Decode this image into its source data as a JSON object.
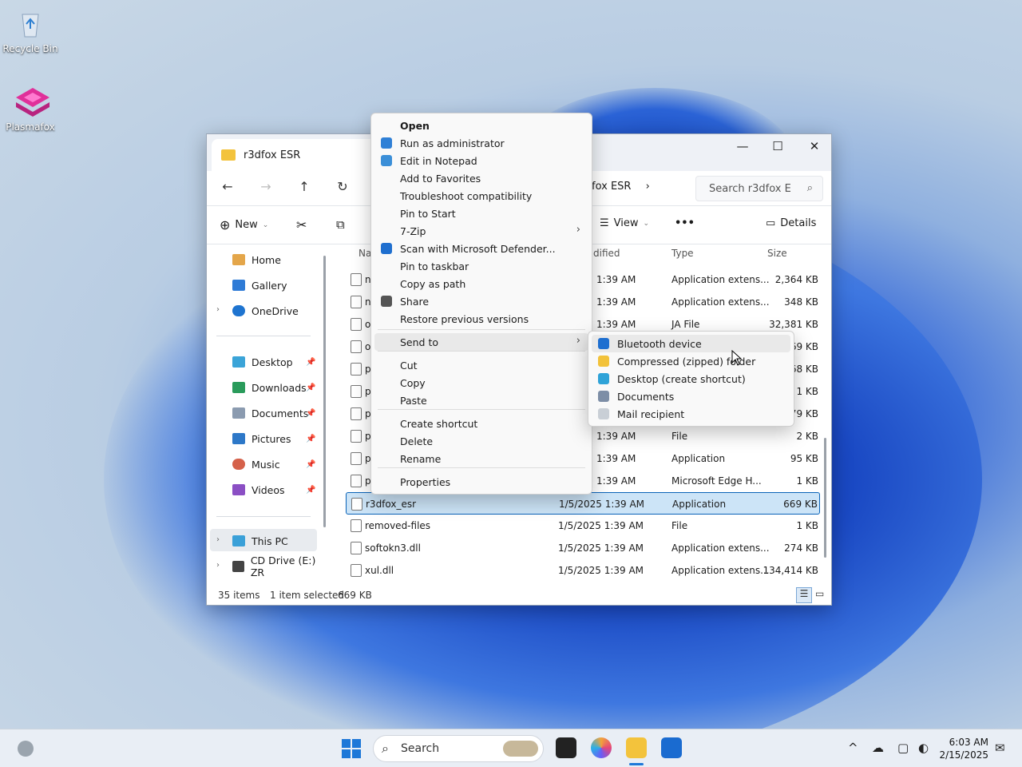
{
  "desktop": {
    "icons": [
      {
        "label": "Recycle Bin",
        "icon": "recycle-bin-icon"
      },
      {
        "label": "Plasmafox",
        "icon": "plasmafox-icon"
      }
    ]
  },
  "explorer": {
    "tab_title": "r3dfox ESR",
    "window_buttons": {
      "minimize": "—",
      "maximize": "☐",
      "close": "✕"
    },
    "nav": {
      "back": "←",
      "forward": "→",
      "up": "↑",
      "refresh": "↻"
    },
    "breadcrumb": "fox ESR",
    "breadcrumb_chevron": "›",
    "search_placeholder": "Search r3dfox E",
    "commands": {
      "new": "New",
      "view": "View",
      "more": "•••",
      "details": "Details"
    },
    "sidebar": {
      "home": "Home",
      "gallery": "Gallery",
      "onedrive": "OneDrive",
      "desktop": "Desktop",
      "downloads": "Downloads",
      "documents": "Documents",
      "pictures": "Pictures",
      "music": "Music",
      "videos": "Videos",
      "this_pc": "This PC",
      "cd_drive": "CD Drive (E:) ZR"
    },
    "columns": {
      "name": "Na",
      "modified": "dified",
      "type": "Type",
      "size": "Size"
    },
    "rows": [
      {
        "name": "n",
        "modified": "1:39 AM",
        "type": "Application extens...",
        "size": "2,364 KB"
      },
      {
        "name": "n",
        "modified": "1:39 AM",
        "type": "Application extens...",
        "size": "348 KB"
      },
      {
        "name": "o",
        "modified": "1:39 AM",
        "type": "JA File",
        "size": "32,381 KB"
      },
      {
        "name": "o",
        "modified": "",
        "type": "",
        "size": "69 KB"
      },
      {
        "name": "p",
        "modified": "",
        "type": "",
        "size": "68 KB"
      },
      {
        "name": "p",
        "modified": "",
        "type": "",
        "size": "1 KB"
      },
      {
        "name": "p",
        "modified": "",
        "type": "",
        "size": "279 KB"
      },
      {
        "name": "p",
        "modified": "1:39 AM",
        "type": "File",
        "size": "2 KB"
      },
      {
        "name": "p",
        "modified": "1:39 AM",
        "type": "Application",
        "size": "95 KB"
      },
      {
        "name": "p",
        "modified": "1:39 AM",
        "type": "Microsoft Edge H...",
        "size": "1 KB"
      },
      {
        "name": "r3dfox_esr",
        "modified": "1/5/2025 1:39 AM",
        "type": "Application",
        "size": "669 KB"
      },
      {
        "name": "removed-files",
        "modified": "1/5/2025 1:39 AM",
        "type": "File",
        "size": "1 KB"
      },
      {
        "name": "softokn3.dll",
        "modified": "1/5/2025 1:39 AM",
        "type": "Application extens...",
        "size": "274 KB"
      },
      {
        "name": "xul.dll",
        "modified": "1/5/2025 1:39 AM",
        "type": "Application extens...",
        "size": "134,414 KB"
      }
    ],
    "status": {
      "items": "35 items",
      "selected": "1 item selected",
      "size": "669 KB"
    }
  },
  "context_menu": {
    "items": [
      {
        "label": "Open",
        "icon": ""
      },
      {
        "label": "Run as administrator",
        "icon": "shield-icon"
      },
      {
        "label": "Edit in Notepad",
        "icon": "notepad-icon"
      },
      {
        "label": "Add to Favorites",
        "icon": ""
      },
      {
        "label": "Troubleshoot compatibility",
        "icon": ""
      },
      {
        "label": "Pin to Start",
        "icon": ""
      },
      {
        "label": "7-Zip",
        "icon": ""
      },
      {
        "label": "Scan with Microsoft Defender...",
        "icon": "defender-icon"
      },
      {
        "label": "Pin to taskbar",
        "icon": ""
      },
      {
        "label": "Copy as path",
        "icon": ""
      },
      {
        "label": "Share",
        "icon": "share-icon"
      },
      {
        "label": "Restore previous versions",
        "icon": ""
      },
      {
        "label": "Send to",
        "icon": ""
      },
      {
        "label": "Cut",
        "icon": ""
      },
      {
        "label": "Copy",
        "icon": ""
      },
      {
        "label": "Paste",
        "icon": ""
      },
      {
        "label": "Create shortcut",
        "icon": ""
      },
      {
        "label": "Delete",
        "icon": ""
      },
      {
        "label": "Rename",
        "icon": ""
      },
      {
        "label": "Properties",
        "icon": ""
      }
    ],
    "submenu_arrow": "›"
  },
  "send_to_menu": {
    "items": [
      {
        "label": "Bluetooth device",
        "icon": "bluetooth-icon"
      },
      {
        "label": "Compressed (zipped) folder",
        "icon": "zip-folder-icon"
      },
      {
        "label": "Desktop (create shortcut)",
        "icon": "desktop-icon"
      },
      {
        "label": "Documents",
        "icon": "documents-icon"
      },
      {
        "label": "Mail recipient",
        "icon": "mail-icon"
      }
    ]
  },
  "taskbar": {
    "search_label": "Search",
    "time": "6:03 AM",
    "date": "2/15/2025",
    "tray": {
      "chevron": "^"
    }
  },
  "colors": {
    "selection": "#cce4f7",
    "accent": "#0a63b8"
  }
}
